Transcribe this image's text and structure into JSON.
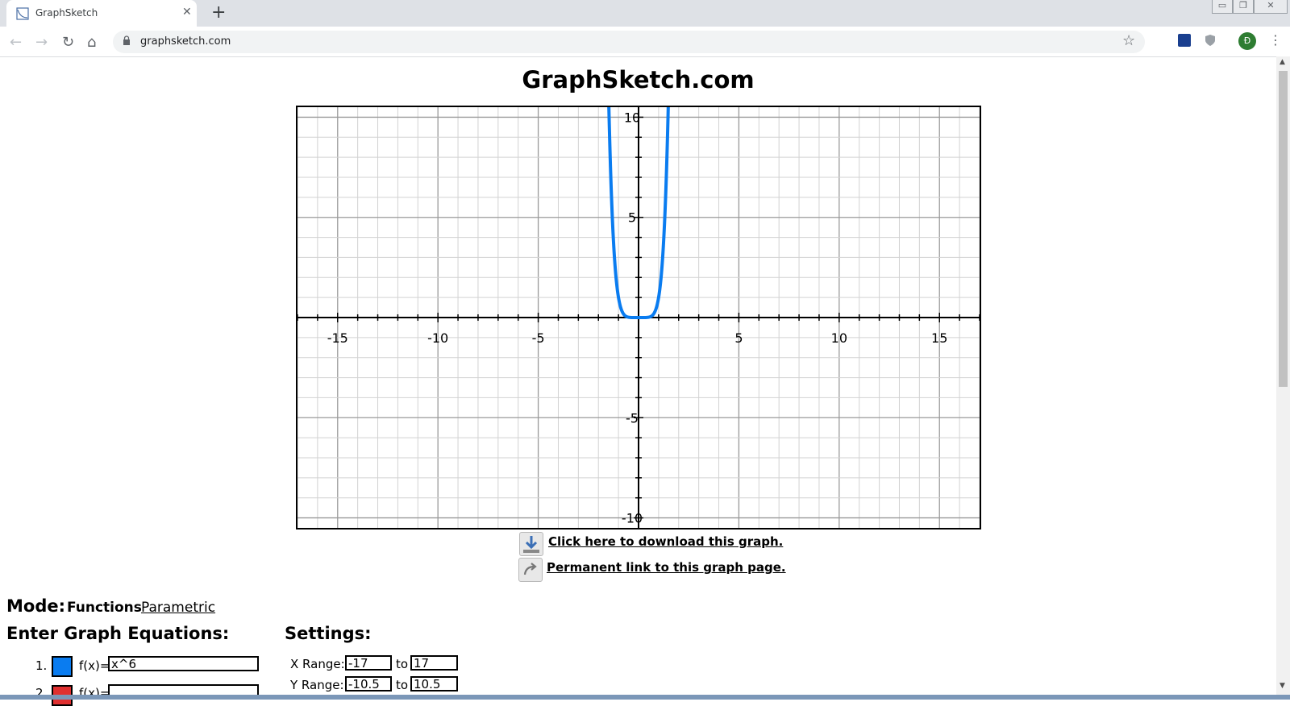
{
  "browser": {
    "tab_title": "GraphSketch",
    "tab_close": "✕",
    "new_tab": "+",
    "url": "graphsketch.com",
    "avatar_letter": "Đ",
    "back": "←",
    "forward": "→",
    "reload": "↻",
    "home": "⌂",
    "star": "☆",
    "menu": "⋮",
    "win_min": "▭",
    "win_restore": "❐",
    "win_close": "✕"
  },
  "page": {
    "title": "GraphSketch.com",
    "download_link": "Click here to download this graph.",
    "permalink": "Permanent link to this graph page.",
    "mode_label": "Mode:",
    "mode_functions": "Functions",
    "mode_parametric": "Parametric",
    "equations_heading": "Enter Graph Equations:",
    "settings_heading": "Settings:",
    "equations": [
      {
        "num": "1.",
        "label": "f(x)=",
        "value": "x^6",
        "color": "#0a7cf0"
      },
      {
        "num": "2.",
        "label": "f(x)=",
        "value": "",
        "color": "#e03030"
      }
    ],
    "settings": {
      "x_range_label": "X Range:",
      "x_min": "-17",
      "x_to": "to",
      "x_max": "17",
      "y_range_label": "Y Range:",
      "y_min": "-10.5",
      "y_to": "to",
      "y_max": "10.5"
    }
  },
  "chart_data": {
    "type": "line",
    "function": "x^6",
    "xlim": [
      -17,
      17
    ],
    "ylim": [
      -10.5,
      10.5
    ],
    "x_ticks": [
      -15,
      -10,
      -5,
      5,
      10,
      15
    ],
    "y_ticks": [
      10,
      5,
      -5,
      -10
    ],
    "x_tick_labels": [
      "-15",
      "-10",
      "-5",
      "5",
      "10",
      "15"
    ],
    "y_tick_labels": [
      "10",
      "5",
      "-5",
      "-10"
    ],
    "grid": true,
    "series": [
      {
        "color": "#0a7cf0"
      }
    ]
  }
}
